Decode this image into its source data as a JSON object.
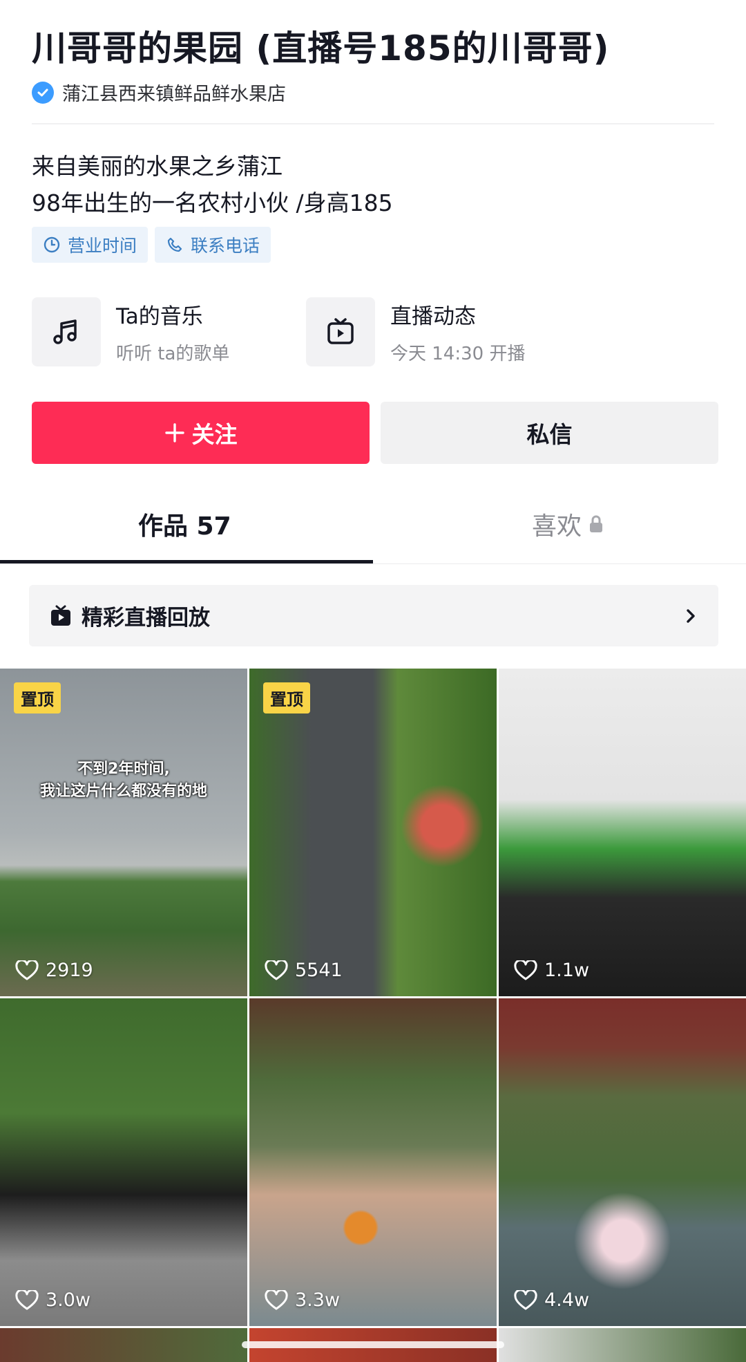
{
  "profile": {
    "name": "川哥哥的果园 (直播号185的川哥哥)",
    "verified_label": "蒲江县西来镇鲜品鲜水果店",
    "bio_line1": "来自美丽的水果之乡蒲江",
    "bio_line2": "98年出生的一名农村小伙 /身高185"
  },
  "chips": {
    "hours": "营业时间",
    "phone": "联系电话"
  },
  "cards": {
    "music_title": "Ta的音乐",
    "music_sub": "听听 ta的歌单",
    "live_title": "直播动态",
    "live_sub": "今天 14:30 开播"
  },
  "actions": {
    "follow_label": "关注",
    "message_label": "私信"
  },
  "tabs": {
    "works_label": "作品 57",
    "likes_label": "喜欢"
  },
  "replay": {
    "label": "精彩直播回放"
  },
  "videos": [
    {
      "likes": "2919",
      "pinned_label": "置顶",
      "overlay_line1": "不到2年时间,",
      "overlay_line2": "我让这片什么都没有的地"
    },
    {
      "likes": "5541",
      "pinned_label": "置顶"
    },
    {
      "likes": "1.1w"
    },
    {
      "likes": "3.0w"
    },
    {
      "likes": "3.3w"
    },
    {
      "likes": "4.4w"
    }
  ],
  "colors": {
    "accent": "#fe2c55",
    "pin_badge": "#f9d447",
    "chip_text": "#3b7ec2",
    "verify_blue": "#3c9cff"
  }
}
